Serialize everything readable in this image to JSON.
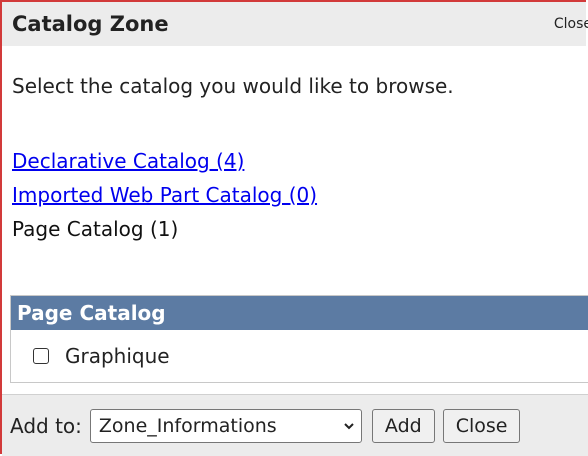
{
  "zone": {
    "title": "Catalog Zone",
    "close_link": "Close",
    "instruction": "Select the catalog you would like to browse."
  },
  "catalogs": [
    {
      "label": "Declarative Catalog (4)",
      "link": true
    },
    {
      "label": "Imported Web Part Catalog (0)",
      "link": true
    },
    {
      "label": "Page Catalog (1)",
      "link": false
    }
  ],
  "part_section": {
    "header": "Page Catalog",
    "items": [
      {
        "label": "Graphique",
        "checked": false
      }
    ]
  },
  "footer": {
    "add_to_label": "Add to:",
    "selected_zone": "Zone_Informations",
    "add_button": "Add",
    "close_button": "Close"
  },
  "colors": {
    "border": "#d23a3a",
    "header_bg": "#ececec",
    "section_header_bg": "#5c7ba3",
    "link": "#0000ee"
  }
}
